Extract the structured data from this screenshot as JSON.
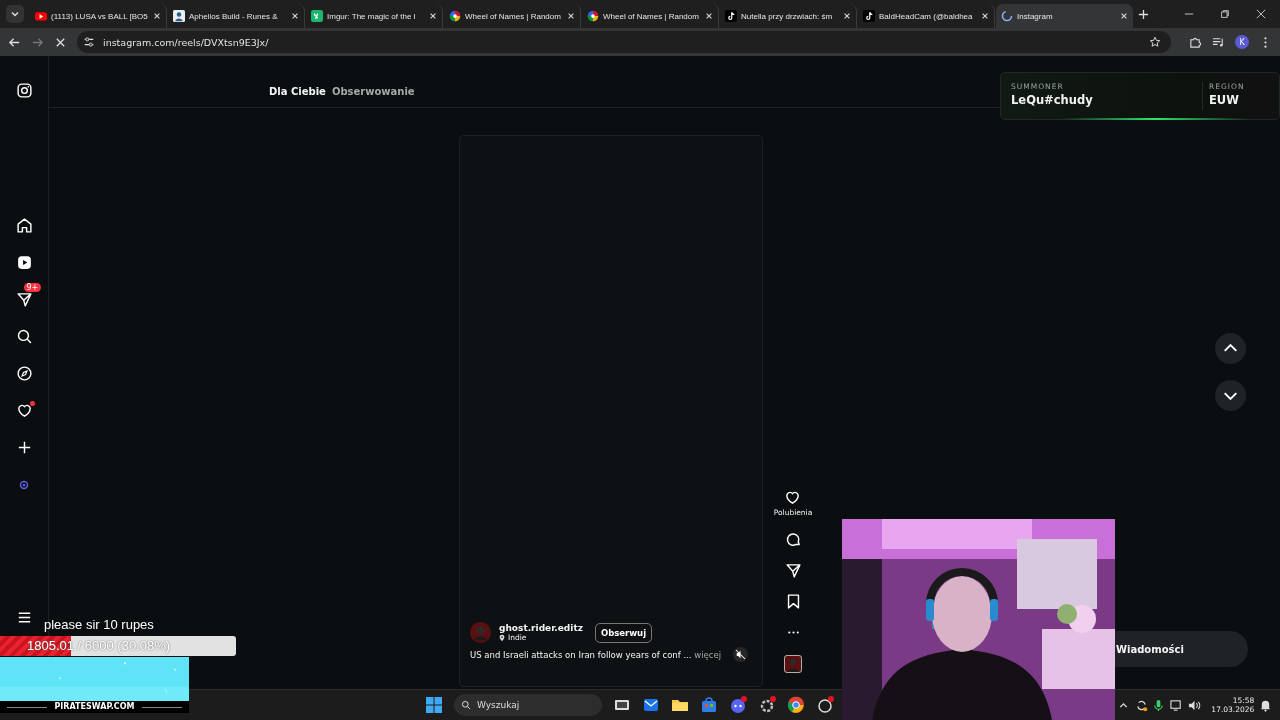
{
  "browser": {
    "tabs": [
      {
        "title": "(1113) LUSA vs BALL [BO5",
        "kind": "youtube",
        "selected": false
      },
      {
        "title": "Aphelios Build - Runes &",
        "kind": "portrait",
        "selected": false
      },
      {
        "title": "Imgur: The magic of the I",
        "kind": "imgur",
        "selected": false
      },
      {
        "title": "Wheel of Names | Random",
        "kind": "wheel",
        "selected": false
      },
      {
        "title": "Wheel of Names | Random",
        "kind": "wheel",
        "selected": false
      },
      {
        "title": "Nutella przy drzwiach: śm",
        "kind": "tiktok",
        "selected": false
      },
      {
        "title": "BaldHeadCam (@baldhea",
        "kind": "tiktok",
        "selected": false
      },
      {
        "title": "Instagram",
        "kind": "loading",
        "selected": true
      }
    ],
    "address": "instagram.com/reels/DVXtsn9E3Jx/",
    "loading": true,
    "profile_initial": "K"
  },
  "sidebar": {
    "items": [
      {
        "kind": "instagram"
      },
      {
        "kind": "home"
      },
      {
        "kind": "reels"
      },
      {
        "kind": "direct",
        "badge": "9+"
      },
      {
        "kind": "search"
      },
      {
        "kind": "explore"
      },
      {
        "kind": "notifications",
        "dot": true
      },
      {
        "kind": "create"
      },
      {
        "kind": "meta"
      },
      {
        "kind": "menu"
      }
    ]
  },
  "feed_tabs": [
    {
      "label": "Dla Ciebie",
      "selected": true
    },
    {
      "label": "Obserwowanie",
      "selected": false
    }
  ],
  "reel": {
    "author": "ghost.rider.editz",
    "location": "Indie",
    "follow_label": "Obserwuj",
    "caption": "US and Israeli attacks on Iran follow years of conf ...",
    "more": "więcej",
    "muted": true,
    "like_label": "Polubienia"
  },
  "messages": {
    "label": "Wiadomości"
  },
  "summoner": {
    "summoner_label": "SUMMONER",
    "name": "LeQu#chudy",
    "region_label": "REGION",
    "region": "EUW"
  },
  "donation": {
    "message": "please sir 10 rupes",
    "progress": "1805.01 / 6000 (30.08%)",
    "level": 0.3008
  },
  "ad": {
    "kind": "picture",
    "caption": "PIRATESWAP.COM"
  },
  "taskbar": {
    "search_placeholder": "Wyszukaj",
    "time": "15:58",
    "date": "17.03.2026"
  }
}
